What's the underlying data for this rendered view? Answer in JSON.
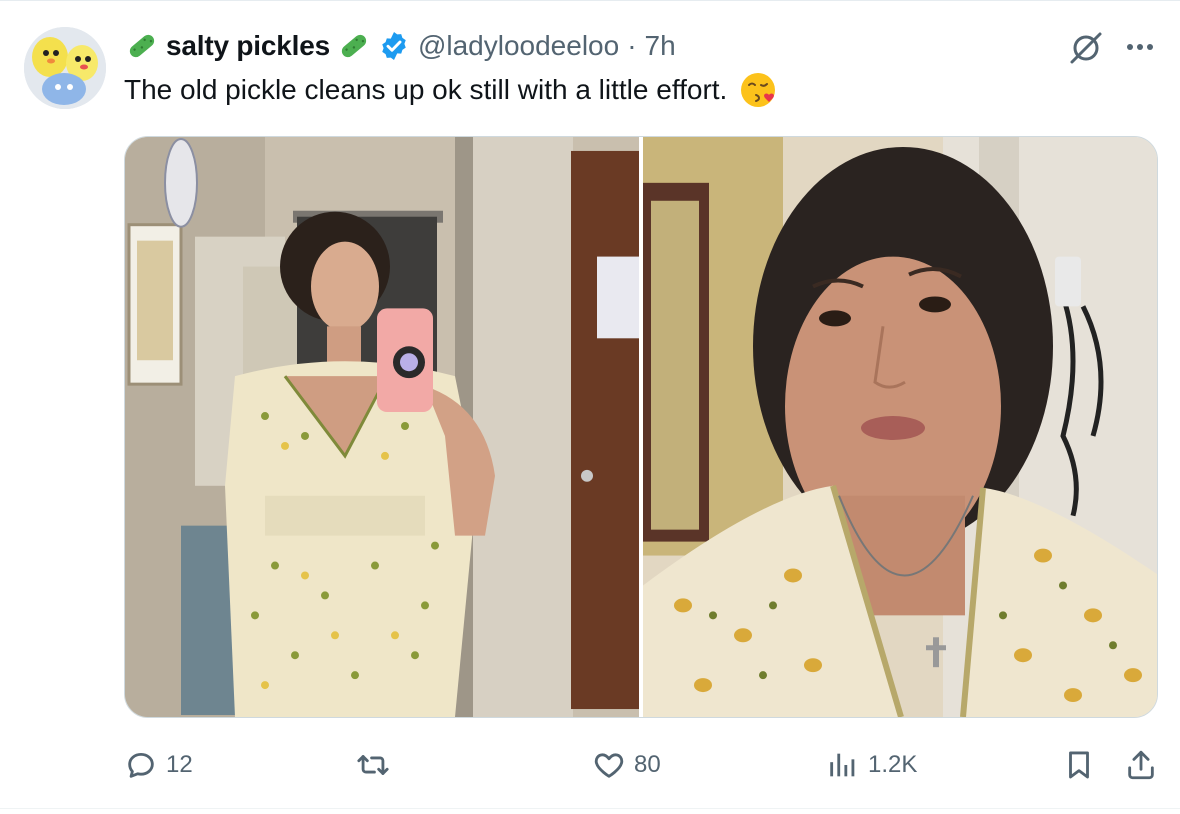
{
  "tweet": {
    "display_name": "salty pickles",
    "handle": "@ladyloodeeloo",
    "separator": "·",
    "time": "7h",
    "text": "The old pickle cleans up ok still with a little effort.",
    "emoji": "face-blowing-a-kiss",
    "verified": true
  },
  "media": {
    "count": 2
  },
  "actions": {
    "replies": "12",
    "retweets": "",
    "likes": "80",
    "views": "1.2K"
  },
  "colors": {
    "text": "#0f1419",
    "secondary": "#536471",
    "verified": "#1d9bf0",
    "border": "#cfd9de",
    "pickle": "#4caf50"
  },
  "icons": {
    "name_prefix": "cucumber-icon",
    "name_suffix": "cucumber-icon",
    "verified": "verified-badge-icon",
    "grok": "grok-icon",
    "more": "more-icon",
    "reply": "reply-icon",
    "retweet": "retweet-icon",
    "like": "heart-icon",
    "views": "views-icon",
    "bookmark": "bookmark-icon",
    "share": "share-icon"
  }
}
